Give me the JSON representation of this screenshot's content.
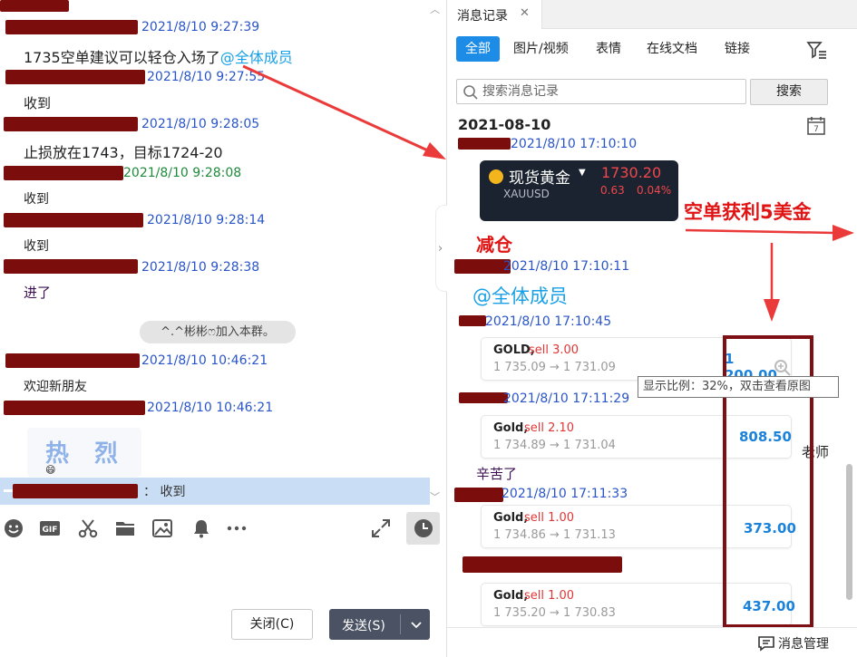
{
  "chat": {
    "messages": [
      {
        "time": "2021/8/10 9:27:39",
        "text": "1735空单建议可以轻仓入场了",
        "mention": "@全体成员"
      },
      {
        "time": "2021/8/10 9:27:55",
        "text": "收到"
      },
      {
        "time": "2021/8/10 9:28:05",
        "text": "止损放在1743，目标1724-20"
      },
      {
        "time": "2021/8/10 9:28:08",
        "text": "收到"
      },
      {
        "time": "2021/8/10 9:28:14",
        "text": "收到"
      },
      {
        "time": "2021/8/10 9:28:38",
        "text": "进了"
      },
      {
        "time": "2021/8/10 10:46:21",
        "text": "欢迎新朋友"
      },
      {
        "time": "2021/8/10 10:46:21",
        "sticker": [
          "热",
          "烈"
        ]
      }
    ],
    "system_notice": "^.^彬彬ෆ加入本群。",
    "reply_preview": "： 收到",
    "buttons": {
      "close": "关闭(C)",
      "send": "发送(S)"
    }
  },
  "history": {
    "tab_title": "消息记录",
    "filters": [
      "全部",
      "图片/视频",
      "表情",
      "在线文档",
      "链接"
    ],
    "search_placeholder": "搜索消息记录",
    "search_button": "搜索",
    "date_heading": "2021-08-10",
    "quote_card": {
      "name": "现货黄金",
      "symbol": "XAUUSD",
      "price": "1730.20",
      "change": "0.63",
      "change_pct": "0.04%"
    },
    "entries": [
      {
        "time": "2021/8/10 17:10:10"
      },
      {
        "time": "2021/8/10 17:10:11",
        "mention": "@全体成员"
      },
      {
        "time": "2021/8/10 17:10:45",
        "trade": {
          "symbol": "GOLD,",
          "side": "sell 3.00",
          "range": "1 735.09 → 1 731.09",
          "profit": "1 200.00"
        }
      },
      {
        "time": "2021/8/10 17:11:29",
        "trade": {
          "symbol": "Gold,",
          "side": "sell 2.10",
          "range": "1 734.89 → 1 731.04",
          "profit": "808.50"
        }
      },
      {
        "text": "辛苦了",
        "side_text": "老师"
      },
      {
        "time": "2021/8/10 17:11:33",
        "trade": {
          "symbol": "Gold,",
          "side": "sell 1.00",
          "range": "1 734.86 → 1 731.13",
          "profit": "373.00"
        }
      },
      {
        "trade": {
          "symbol": "Gold,",
          "side": "sell 1.00",
          "range": "1 735.20 → 1 730.83",
          "profit": "437.00"
        }
      }
    ],
    "tooltip": "显示比例：32%，双击查看原图",
    "message_manager": "消息管理"
  },
  "annotations": {
    "reduce": "减仓",
    "short_profit": "空单获利5美金"
  },
  "colors": {
    "accent": "#1d8ce6",
    "redaction": "#7b0d0d",
    "annotation_red": "#e01414",
    "frame": "#7e0f14"
  }
}
